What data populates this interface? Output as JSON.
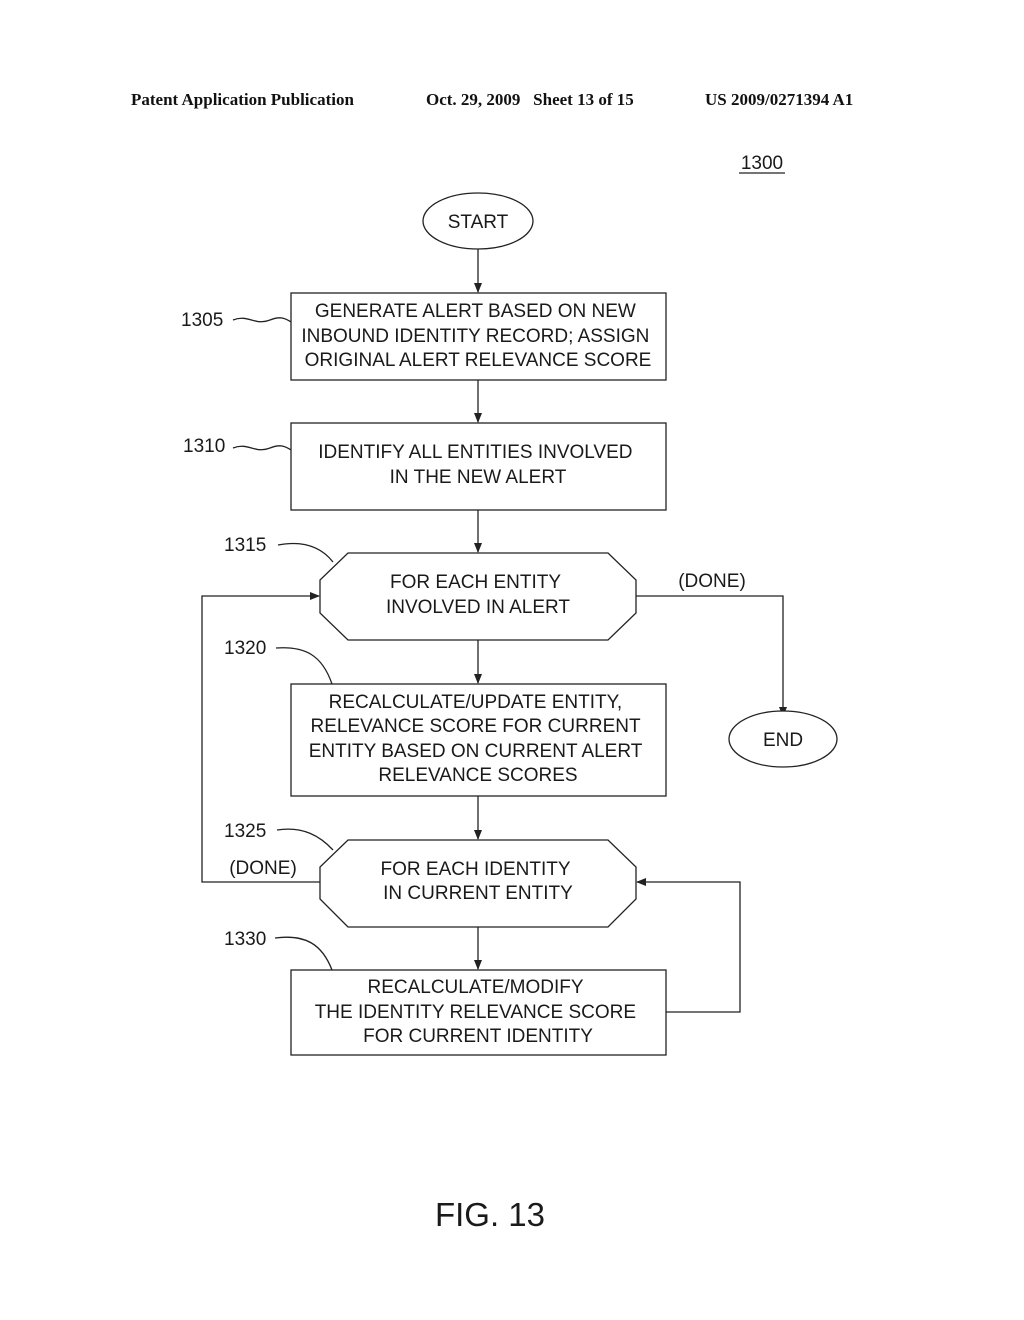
{
  "header": {
    "publication": "Patent Application Publication",
    "date_sheet": "Oct. 29, 2009   Sheet 13 of 15",
    "number": "US 2009/0271394 A1"
  },
  "figure_ref": "1300",
  "figure_caption": "FIG. 13",
  "nodes": {
    "start": {
      "label": "START"
    },
    "end": {
      "label": "END"
    },
    "n1305": {
      "ref": "1305",
      "lines": [
        "GENERATE ALERT BASED ON NEW",
        "INBOUND IDENTITY RECORD; ASSIGN",
        "ORIGINAL ALERT RELEVANCE SCORE"
      ]
    },
    "n1310": {
      "ref": "1310",
      "lines": [
        "IDENTIFY ALL ENTITIES INVOLVED",
        "IN THE NEW ALERT"
      ]
    },
    "n1315": {
      "ref": "1315",
      "lines": [
        "FOR EACH ENTITY",
        "INVOLVED IN ALERT"
      ]
    },
    "n1320": {
      "ref": "1320",
      "lines": [
        "RECALCULATE/UPDATE ENTITY,",
        "RELEVANCE SCORE FOR CURRENT",
        "ENTITY BASED ON CURRENT ALERT",
        "RELEVANCE SCORES"
      ]
    },
    "n1325": {
      "ref": "1325",
      "lines": [
        "FOR EACH IDENTITY",
        "IN CURRENT ENTITY"
      ]
    },
    "n1330": {
      "ref": "1330",
      "lines": [
        "RECALCULATE/MODIFY",
        "THE IDENTITY RELEVANCE SCORE",
        "FOR CURRENT IDENTITY"
      ]
    }
  },
  "edge_labels": {
    "done_1315": "(DONE)",
    "done_1325": "(DONE)"
  }
}
